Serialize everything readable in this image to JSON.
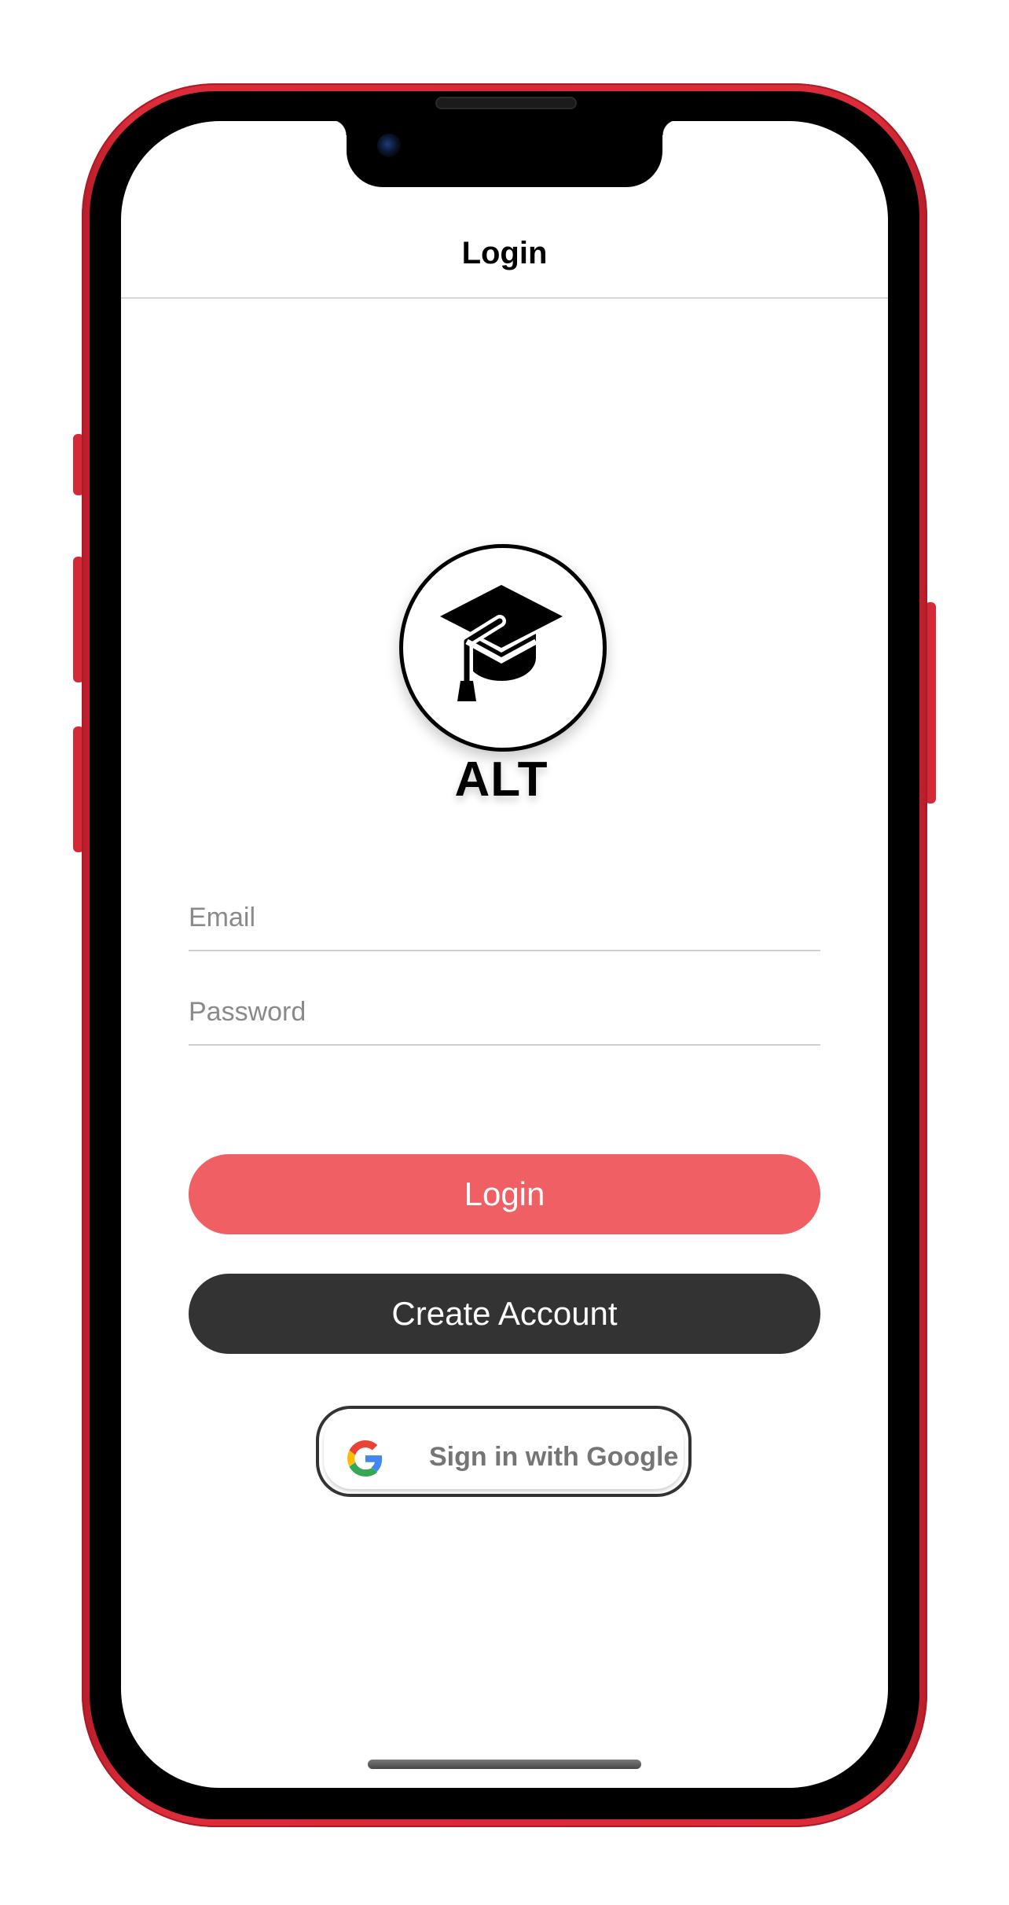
{
  "nav": {
    "title": "Login"
  },
  "logo": {
    "icon": "graduation-cap-icon",
    "wordmark": "ALT"
  },
  "form": {
    "email_placeholder": "Email",
    "email_value": "",
    "password_placeholder": "Password",
    "password_value": ""
  },
  "actions": {
    "login_label": "Login",
    "create_account_label": "Create Account",
    "google_label": "Sign in with Google"
  },
  "colors": {
    "device_frame": "#d92837",
    "login_button": "#f05f63",
    "create_account_button": "#333333",
    "google_label": "#757575"
  }
}
